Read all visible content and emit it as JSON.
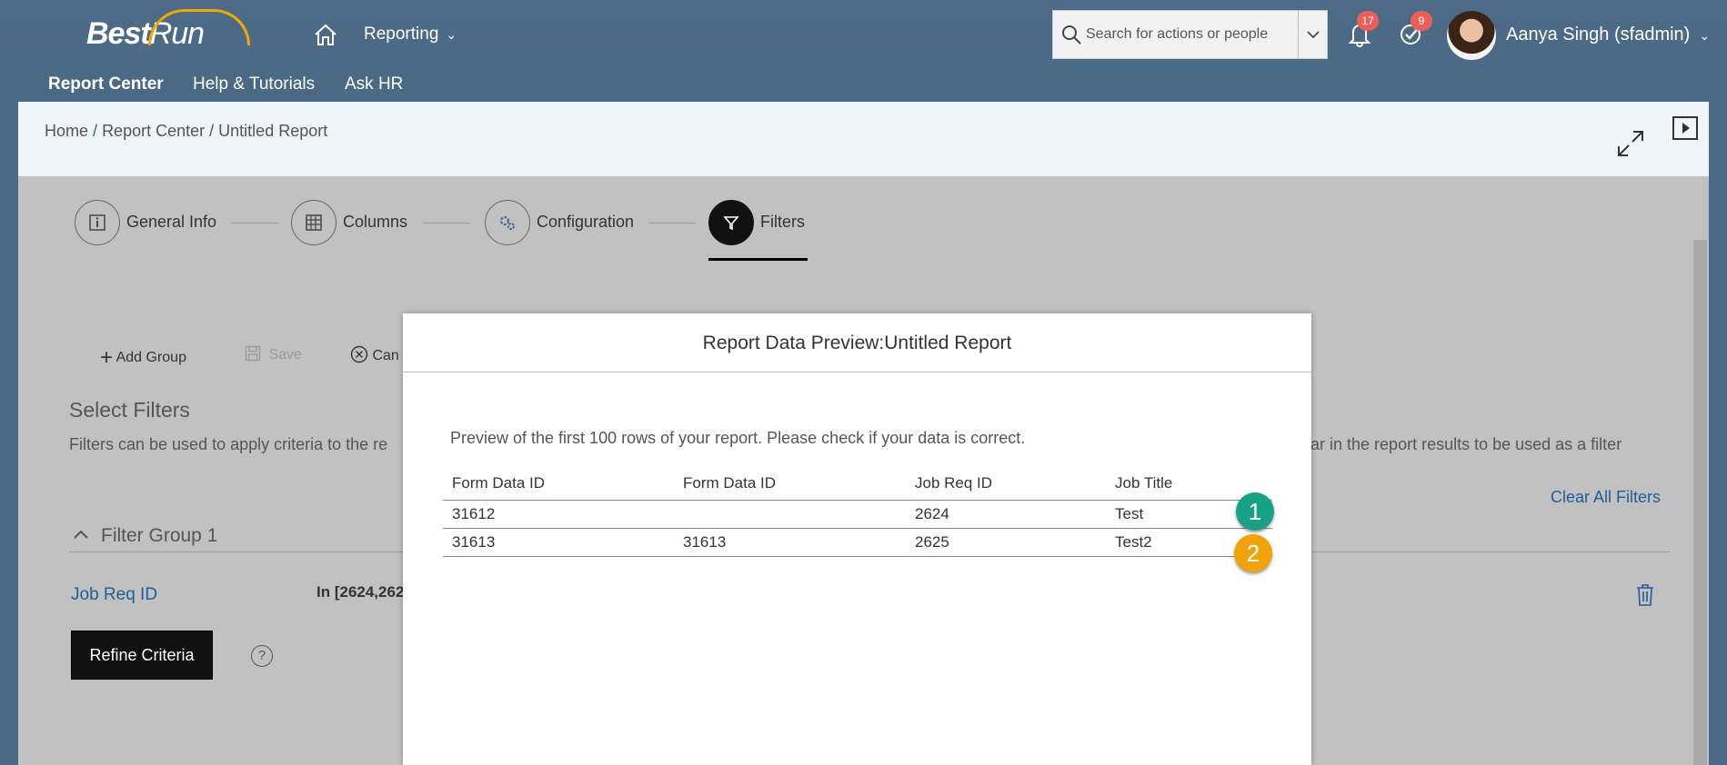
{
  "header": {
    "logo_bold": "Best",
    "logo_regular": "Run",
    "menu_label": "Reporting",
    "search_placeholder": "Search for actions or people",
    "notifications_count": "17",
    "tasks_count": "9",
    "user_name": "Aanya Singh (sfadmin)"
  },
  "subnav": [
    "Report Center",
    "Help & Tutorials",
    "Ask HR"
  ],
  "breadcrumb": [
    "Home",
    "Report Center",
    "Untitled Report"
  ],
  "breadcrumb_sep": "/",
  "steps": [
    {
      "label": "General Info",
      "icon": "info-icon"
    },
    {
      "label": "Columns",
      "icon": "grid-icon"
    },
    {
      "label": "Configuration",
      "icon": "gears-icon"
    },
    {
      "label": "Filters",
      "icon": "filter-icon",
      "active": true
    }
  ],
  "toolbar": {
    "add_group": "Add Group",
    "save": "Save",
    "cancel": "Can"
  },
  "filters": {
    "title": "Select Filters",
    "description": "Filters can be used to apply criteria to the re",
    "description_tail": "ear in the report results to be used as a filter",
    "clear_all": "Clear All Filters",
    "group_title": "Filter Group 1",
    "field_label": "Job Req ID",
    "field_value": "In [2624,262",
    "refine_button": "Refine Criteria",
    "help_glyph": "?"
  },
  "modal": {
    "title": "Report Data Preview:Untitled Report",
    "note": "Preview of the first 100 rows of your report. Please check if your data is correct.",
    "columns": [
      "Form Data ID",
      "Form Data ID",
      "Job Req ID",
      "Job Title"
    ],
    "rows": [
      [
        "31612",
        "",
        "2624",
        "Test"
      ],
      [
        "31613",
        "31613",
        "2625",
        "Test2"
      ]
    ]
  },
  "markers": [
    {
      "label": "1",
      "color": "#16a085"
    },
    {
      "label": "2",
      "color": "#f0a30a"
    }
  ],
  "colors": {
    "shell": "#4a6984",
    "link": "#1f5d99",
    "overlay": "#c1c1c1"
  }
}
